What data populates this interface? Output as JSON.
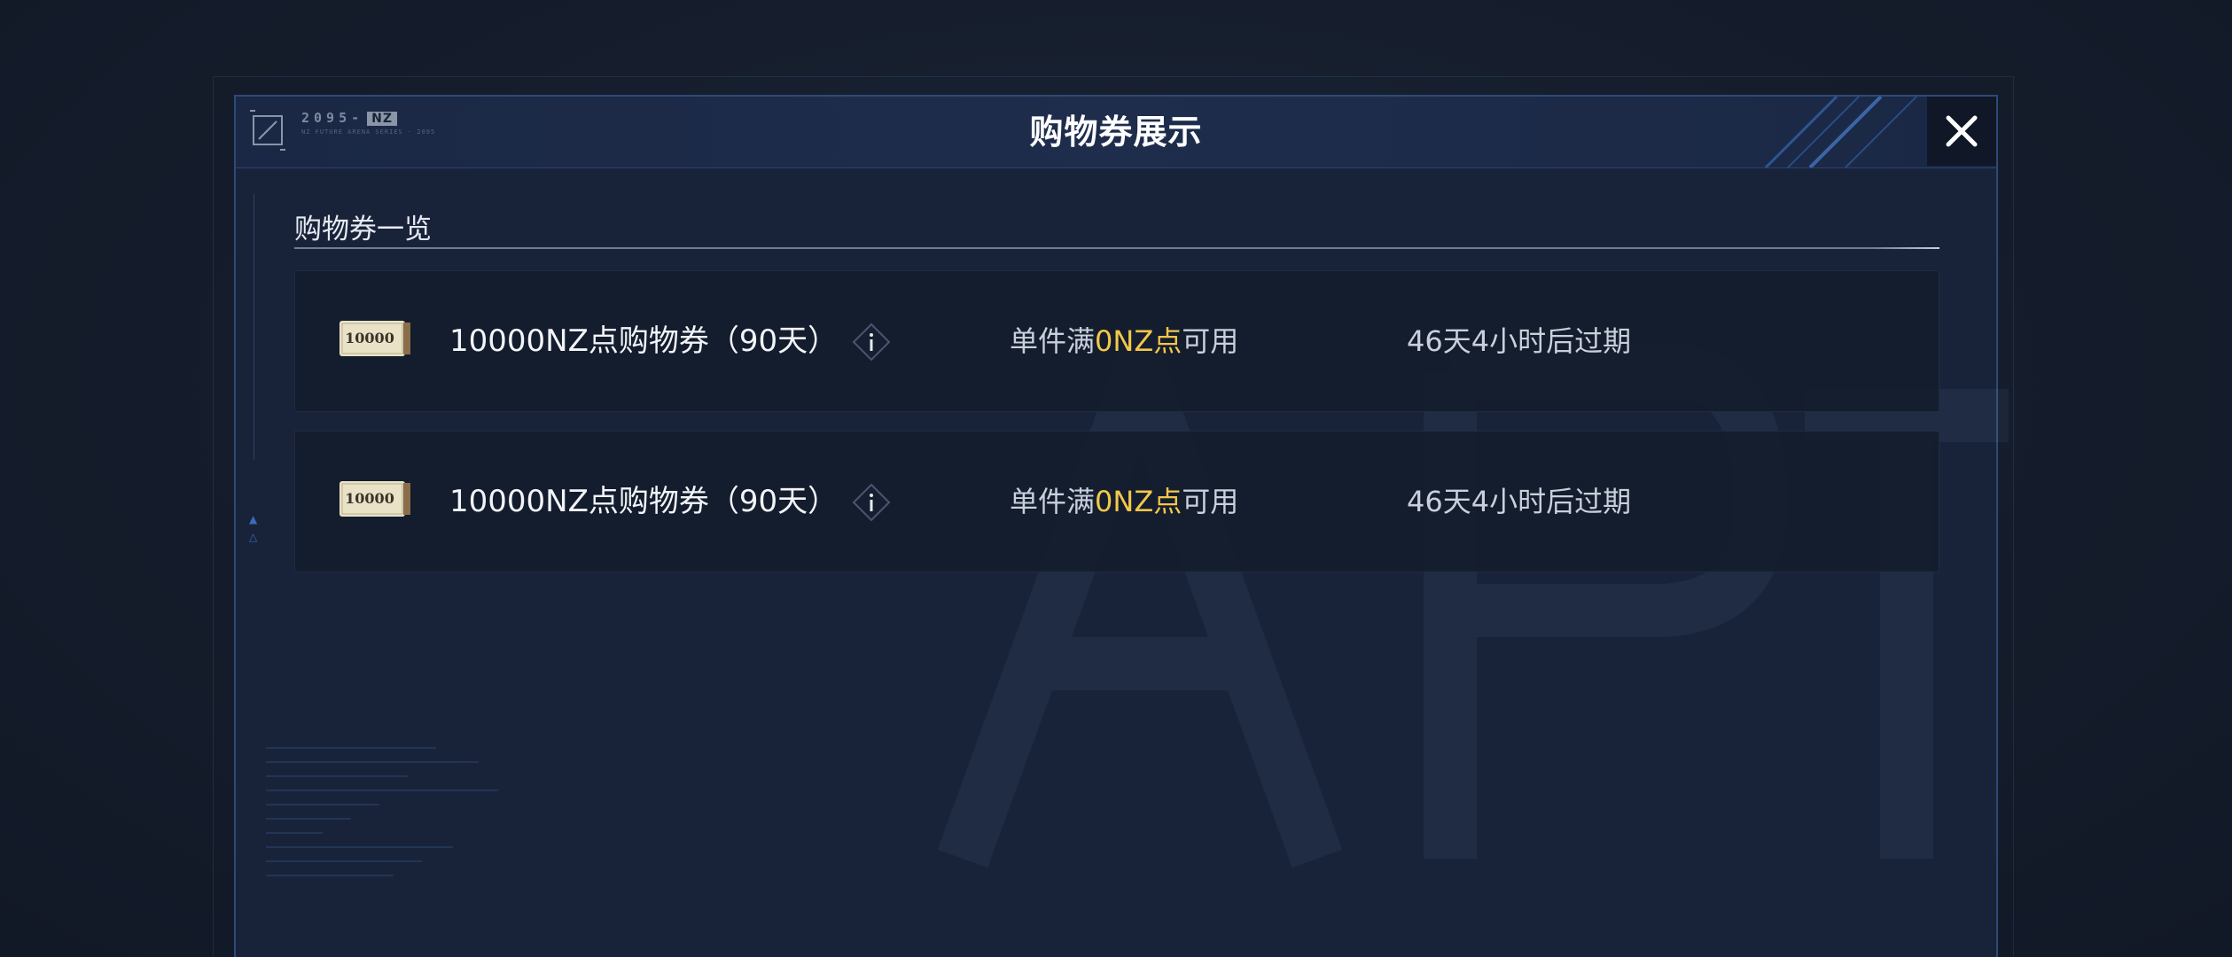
{
  "dialog": {
    "title": "购物券展示",
    "logo": {
      "year": "2095-",
      "badge": "NZ",
      "subtitle": "NZ FUTURE ARENA SERIES · 2095"
    },
    "close_icon": "close-icon"
  },
  "section": {
    "title": "购物券一览"
  },
  "coupons": [
    {
      "ticket_value": "10000",
      "name": "10000NZ点购物券（90天）",
      "condition_prefix": "单件满",
      "condition_highlight": "0NZ点",
      "condition_suffix": "可用",
      "expiry": "46天4小时后过期"
    },
    {
      "ticket_value": "10000",
      "name": "10000NZ点购物券（90天）",
      "condition_prefix": "单件满",
      "condition_highlight": "0NZ点",
      "condition_suffix": "可用",
      "expiry": "46天4小时后过期"
    }
  ],
  "colors": {
    "background": "#141c2b",
    "dialog": "#18233a",
    "border": "#2d4a78",
    "highlight": "#f3c74a",
    "text": "#c9d0dc"
  }
}
